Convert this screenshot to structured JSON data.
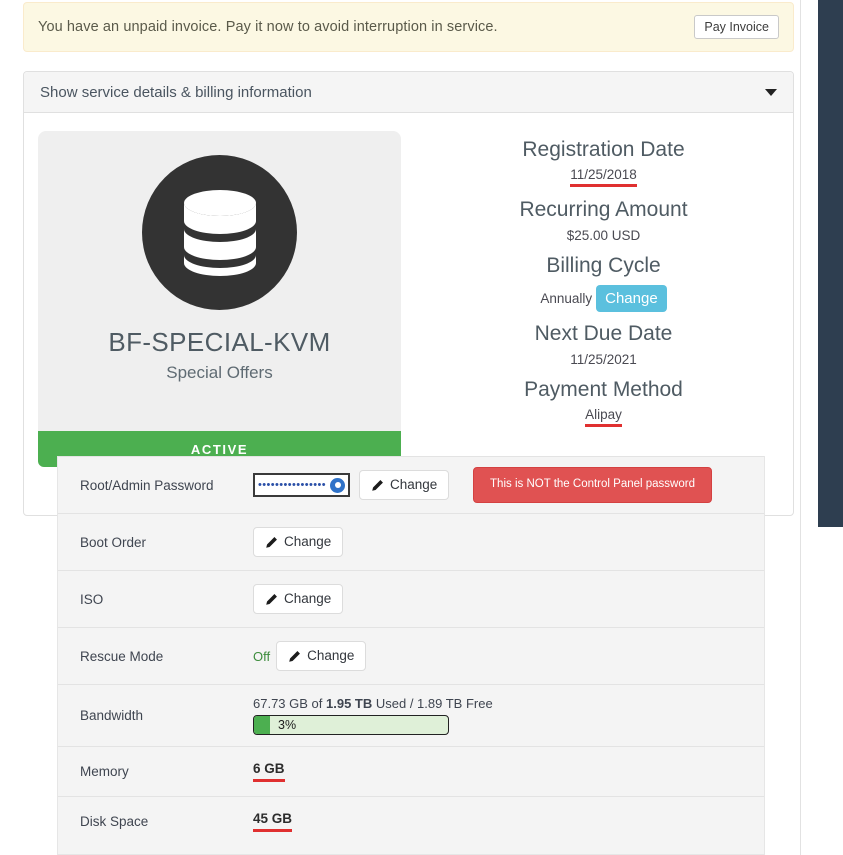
{
  "alert": {
    "message": "You have an unpaid invoice. Pay it now to avoid interruption in service.",
    "button_label": "Pay Invoice"
  },
  "panel": {
    "header_title": "Show service details & billing information",
    "caret_icon": "chevron-down-icon"
  },
  "product": {
    "icon": "database-icon",
    "name": "BF-SPECIAL-KVM",
    "group": "Special Offers",
    "status": "ACTIVE",
    "status_color": "#4caf50"
  },
  "billing": {
    "registration_date_label": "Registration Date",
    "registration_date_value": "11/25/2018",
    "recurring_amount_label": "Recurring Amount",
    "recurring_amount_value": "$25.00 USD",
    "billing_cycle_label": "Billing Cycle",
    "billing_cycle_value": "Annually",
    "billing_cycle_change_label": "Change",
    "next_due_date_label": "Next Due Date",
    "next_due_date_value": "11/25/2021",
    "payment_method_label": "Payment Method",
    "payment_method_value": "Alipay",
    "accent_color": "#5bc0de",
    "highlight_color": "#e03030"
  },
  "service_table": {
    "rows": [
      {
        "label": "Root/Admin Password",
        "password_value": "••••••••••••••••",
        "reveal_icon": "eye-icon",
        "change_label": "Change",
        "warning_label": "This is NOT the Control Panel password"
      },
      {
        "label": "Boot Order",
        "change_label": "Change"
      },
      {
        "label": "ISO",
        "change_label": "Change"
      },
      {
        "label": "Rescue Mode",
        "state": "Off",
        "change_label": "Change"
      },
      {
        "label": "Bandwidth",
        "usage_text_pre": "67.73 GB of ",
        "usage_text_bold": "1.95 TB",
        "usage_text_post": " Used / 1.89 TB Free",
        "percent_label": "3%",
        "percent_value": 3
      },
      {
        "label": "Memory",
        "value": "6 GB"
      },
      {
        "label": "Disk Space",
        "value": "45 GB"
      }
    ],
    "pencil_icon": "pencil-icon",
    "danger_color": "#e05252"
  }
}
